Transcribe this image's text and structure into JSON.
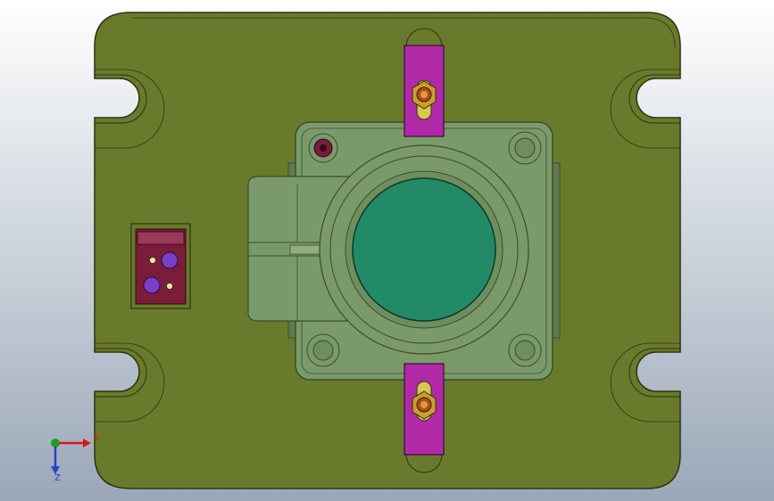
{
  "scene": {
    "colors": {
      "background_top": "#ffffff",
      "background_bottom": "#9aa7b8",
      "base_plate": "#6a7a2c",
      "base_plate_edge": "#2c3410",
      "housing": "#7a9a6a",
      "housing_edge": "#3a4e30",
      "lens": "#238a68",
      "clamp": "#b02aa8",
      "nut": "#c8a028",
      "connector": "#7a1c3a"
    }
  },
  "triad": {
    "x_label": "X",
    "y_label": "Z",
    "x_color": "#d01a1a",
    "y_color": "#2a3fc8",
    "origin_color": "#1aa01a"
  }
}
